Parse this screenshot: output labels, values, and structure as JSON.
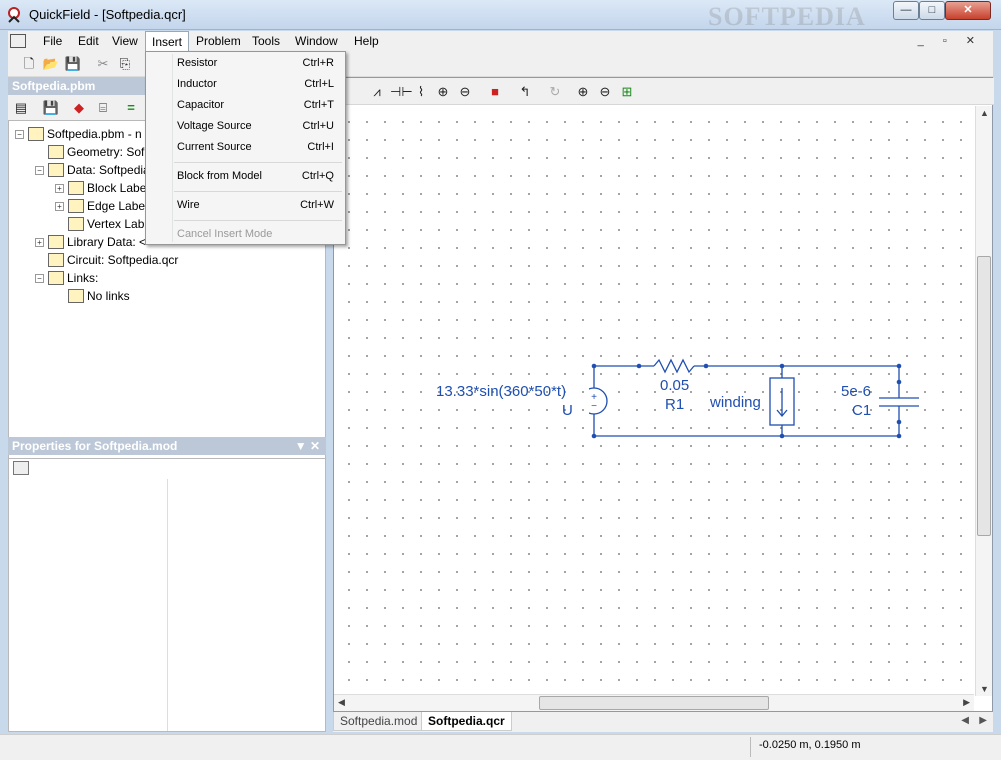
{
  "window": {
    "app_name": "QuickField",
    "title": "QuickField - [Softpedia.qcr]",
    "watermark": "SOFTPEDIA"
  },
  "caption_buttons": {
    "minimize": "—",
    "maximize": "□",
    "close": "✕"
  },
  "menubar": {
    "items": [
      "File",
      "Edit",
      "View",
      "Insert",
      "Problem",
      "Tools",
      "Window",
      "Help"
    ],
    "active": "Insert",
    "mdi_controls": "_ ▫ ✕"
  },
  "insert_menu": {
    "items": [
      {
        "label": "Resistor",
        "shortcut": "Ctrl+R",
        "enabled": true
      },
      {
        "label": "Inductor",
        "shortcut": "Ctrl+L",
        "enabled": true
      },
      {
        "label": "Capacitor",
        "shortcut": "Ctrl+T",
        "enabled": true
      },
      {
        "label": "Voltage Source",
        "shortcut": "Ctrl+U",
        "enabled": true
      },
      {
        "label": "Current Source",
        "shortcut": "Ctrl+I",
        "enabled": true
      },
      {
        "label": "Block from Model",
        "shortcut": "Ctrl+Q",
        "enabled": true
      },
      {
        "label": "Wire",
        "shortcut": "Ctrl+W",
        "enabled": true
      },
      {
        "label": "Cancel Insert Mode",
        "shortcut": "",
        "enabled": false
      }
    ]
  },
  "problem_panel": {
    "title": "Softpedia.pbm",
    "tree": [
      {
        "label": "Softpedia.pbm - n",
        "level": 0,
        "expander": "−"
      },
      {
        "label": "Geometry: Sof",
        "level": 1,
        "expander": ""
      },
      {
        "label": "Data: Softpedia",
        "level": 1,
        "expander": "−"
      },
      {
        "label": "Block Labe",
        "level": 2,
        "expander": "+"
      },
      {
        "label": "Edge Labe",
        "level": 2,
        "expander": "+"
      },
      {
        "label": "Vertex Lab",
        "level": 2,
        "expander": ""
      },
      {
        "label": "Library Data: <",
        "level": 1,
        "expander": "+"
      },
      {
        "label": "Circuit: Softpedia.qcr",
        "level": 1,
        "expander": ""
      },
      {
        "label": "Links:",
        "level": 1,
        "expander": "−"
      },
      {
        "label": "No links",
        "level": 2,
        "expander": ""
      }
    ]
  },
  "properties_panel": {
    "title": "Properties for Softpedia.mod",
    "controls": "▼ ✕"
  },
  "circuit": {
    "source_label": "13.33*sin(360*50*t)",
    "source_name": "U",
    "resistor_value": "0.05",
    "resistor_name": "R1",
    "block_name": "winding",
    "capacitor_value": "5e-6",
    "capacitor_name": "C1"
  },
  "tabs": [
    "Softpedia.mod",
    "Softpedia.qcr"
  ],
  "active_tab": "Softpedia.qcr",
  "status": {
    "coords": "-0.0250 m, 0.1950 m"
  },
  "colors": {
    "circuit": "#1f4fb0",
    "menu_highlight": "#ffffff",
    "titlebar": "#c4d6ec"
  }
}
